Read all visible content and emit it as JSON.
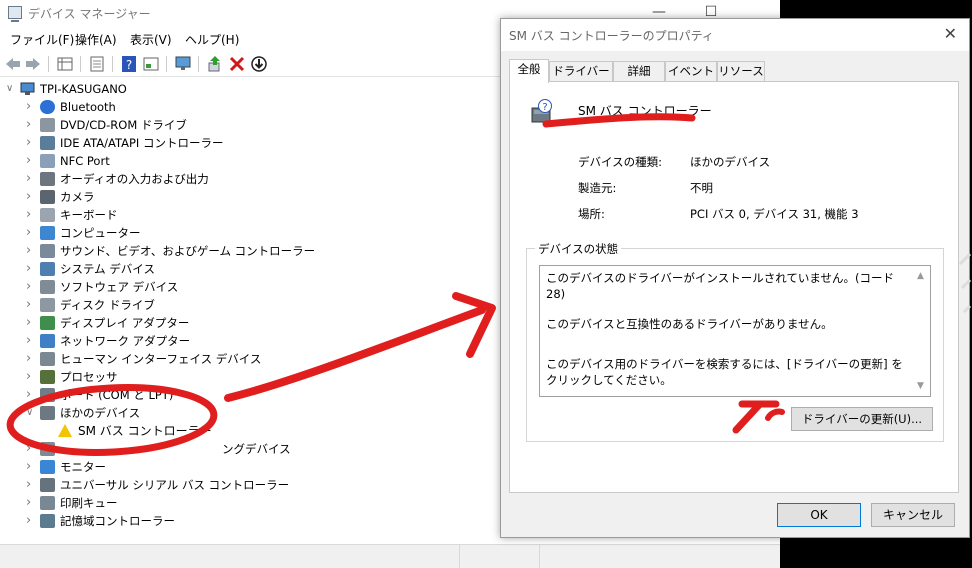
{
  "device_manager": {
    "title": "デバイス マネージャー",
    "menu": [
      "ファイル(F)",
      "操作(A)",
      "表示(V)",
      "ヘルプ(H)"
    ],
    "root": "TPI-KASUGANO",
    "tree": [
      {
        "label": "Bluetooth",
        "icon": "bluetooth-icon",
        "expanded": false
      },
      {
        "label": "DVD/CD-ROM ドライブ",
        "icon": "optical-drive-icon",
        "expanded": false
      },
      {
        "label": "IDE ATA/ATAPI コントローラー",
        "icon": "ide-controller-icon",
        "expanded": false
      },
      {
        "label": "NFC Port",
        "icon": "nfc-icon",
        "expanded": false
      },
      {
        "label": "オーディオの入力および出力",
        "icon": "speaker-icon",
        "expanded": false
      },
      {
        "label": "カメラ",
        "icon": "camera-icon",
        "expanded": false
      },
      {
        "label": "キーボード",
        "icon": "keyboard-icon",
        "expanded": false
      },
      {
        "label": "コンピューター",
        "icon": "computer-icon",
        "expanded": false
      },
      {
        "label": "サウンド、ビデオ、およびゲーム コントローラー",
        "icon": "sound-icon",
        "expanded": false
      },
      {
        "label": "システム デバイス",
        "icon": "system-device-icon",
        "expanded": false
      },
      {
        "label": "ソフトウェア デバイス",
        "icon": "software-device-icon",
        "expanded": false
      },
      {
        "label": "ディスク ドライブ",
        "icon": "disk-drive-icon",
        "expanded": false
      },
      {
        "label": "ディスプレイ アダプター",
        "icon": "display-adapter-icon",
        "expanded": false
      },
      {
        "label": "ネットワーク アダプター",
        "icon": "network-adapter-icon",
        "expanded": false
      },
      {
        "label": "ヒューマン インターフェイス デバイス",
        "icon": "hid-icon",
        "expanded": false
      },
      {
        "label": "プロセッサ",
        "icon": "processor-icon",
        "expanded": false
      },
      {
        "label": "ポート (COM と LPT)",
        "icon": "port-icon",
        "expanded": false
      },
      {
        "label": "ほかのデバイス",
        "icon": "unknown-device-icon",
        "expanded": true
      },
      {
        "label": "SM バス コントローラー",
        "icon": "warning-device-icon",
        "child": true
      },
      {
        "label": "ングデバイス",
        "icon": "pointing-device-icon",
        "expanded": false
      },
      {
        "label": "モニター",
        "icon": "monitor-icon",
        "expanded": false
      },
      {
        "label": "ユニバーサル シリアル バス コントローラー",
        "icon": "usb-icon",
        "expanded": false
      },
      {
        "label": "印刷キュー",
        "icon": "printer-icon",
        "expanded": false
      },
      {
        "label": "記憶域コントローラー",
        "icon": "storage-controller-icon",
        "expanded": false
      }
    ]
  },
  "dialog": {
    "title": "SM バス コントローラーのプロパティ",
    "tabs": [
      "全般",
      "ドライバー",
      "詳細",
      "イベント",
      "リソース"
    ],
    "device_name": "SM バス コントローラー",
    "props": [
      {
        "key": "デバイスの種類:",
        "value": "ほかのデバイス"
      },
      {
        "key": "製造元:",
        "value": "不明"
      },
      {
        "key": "場所:",
        "value": "PCI バス 0, デバイス 31, 機能 3"
      }
    ],
    "status_legend": "デバイスの状態",
    "status_lines": [
      "このデバイスのドライバーがインストールされていません。(コード 28)",
      "このデバイスと互換性のあるドライバーがありません。",
      "このデバイス用のドライバーを検索するには、[ドライバーの更新] をクリックしてください。"
    ],
    "update_button": "ドライバーの更新(U)...",
    "ok": "OK",
    "cancel": "キャンセル"
  },
  "colors": {
    "annotation": "#e01e1e",
    "accent": "#0078d7",
    "warning": "#f2c500"
  }
}
